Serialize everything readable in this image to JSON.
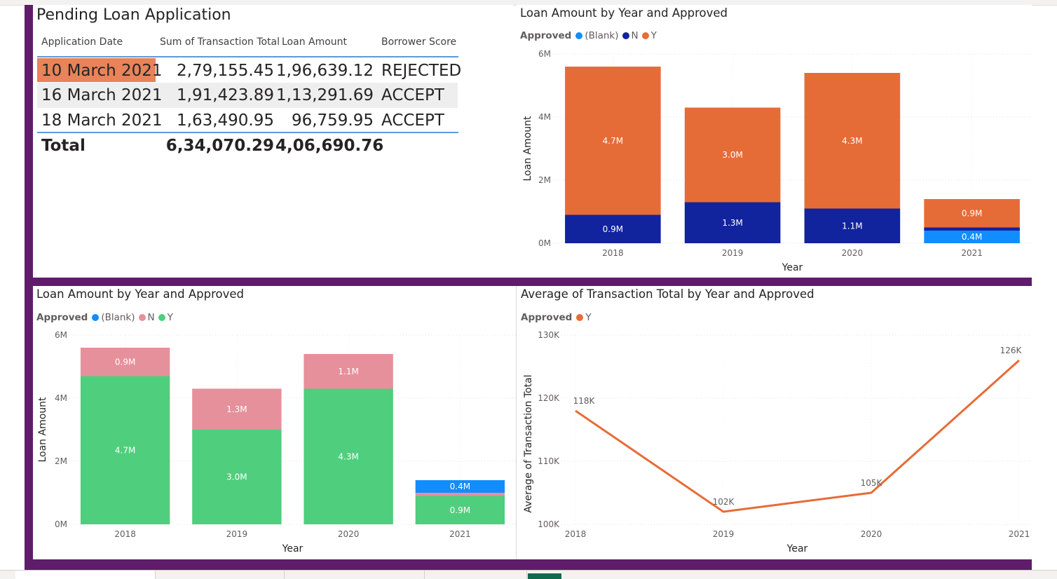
{
  "table": {
    "title": "Pending Loan Application",
    "columns": [
      "Application Date",
      "Sum of Transaction Total",
      "Loan Amount",
      "Borrower Score"
    ],
    "rows": [
      {
        "date": "10 March 2021",
        "transaction": "2,79,155.45",
        "loan": "1,96,639.12",
        "score": "REJECTED"
      },
      {
        "date": "16 March 2021",
        "transaction": "1,91,423.89",
        "loan": "1,13,291.69",
        "score": "ACCEPT"
      },
      {
        "date": "18 March 2021",
        "transaction": "1,63,490.95",
        "loan": "96,759.95",
        "score": "ACCEPT"
      }
    ],
    "total": {
      "label": "Total",
      "transaction": "6,34,070.29",
      "loan": "4,06,690.76"
    },
    "highlight_color": "#e8835a"
  },
  "chart_data": [
    {
      "type": "bar",
      "stacked": true,
      "title": "Loan Amount by Year and Approved",
      "legend_title": "Approved",
      "xlabel": "Year",
      "ylabel": "Loan Amount",
      "categories": [
        "2018",
        "2019",
        "2020",
        "2021"
      ],
      "ylim": [
        0,
        6
      ],
      "yticks": [
        "0M",
        "2M",
        "4M",
        "6M"
      ],
      "series": [
        {
          "name": "(Blank)",
          "color": "#118dff",
          "values": [
            0,
            0,
            0,
            0.4
          ],
          "labels": [
            "",
            "",
            "",
            "0.4M"
          ]
        },
        {
          "name": "N",
          "color": "#12239e",
          "values": [
            0.9,
            1.3,
            1.1,
            0.1
          ],
          "labels": [
            "0.9M",
            "1.3M",
            "1.1M",
            ""
          ]
        },
        {
          "name": "Y",
          "color": "#e66c37",
          "values": [
            4.7,
            3.0,
            4.3,
            0.9
          ],
          "labels": [
            "4.7M",
            "3.0M",
            "4.3M",
            "0.9M"
          ]
        }
      ],
      "grid": true,
      "legend_position": "top-left"
    },
    {
      "type": "bar",
      "stacked": true,
      "title": "Loan Amount by Year and Approved",
      "legend_title": "Approved",
      "xlabel": "Year",
      "ylabel": "Loan Amount",
      "categories": [
        "2018",
        "2019",
        "2020",
        "2021"
      ],
      "ylim": [
        0,
        6
      ],
      "yticks": [
        "0M",
        "2M",
        "4M",
        "6M"
      ],
      "series": [
        {
          "name": "Y",
          "color": "#4fce7e",
          "values": [
            4.7,
            3.0,
            4.3,
            0.9
          ],
          "labels": [
            "4.7M",
            "3.0M",
            "4.3M",
            "0.9M"
          ]
        },
        {
          "name": "N",
          "color": "#e6909b",
          "values": [
            0.9,
            1.3,
            1.1,
            0.1
          ],
          "labels": [
            "0.9M",
            "1.3M",
            "1.1M",
            ""
          ]
        },
        {
          "name": "(Blank)",
          "color": "#118dff",
          "values": [
            0,
            0,
            0,
            0.4
          ],
          "labels": [
            "",
            "",
            "",
            "0.4M"
          ]
        }
      ],
      "legend_order": [
        "(Blank)",
        "N",
        "Y"
      ],
      "grid": true,
      "legend_position": "top-left"
    },
    {
      "type": "line",
      "title": "Average of Transaction Total by Year and Approved",
      "legend_title": "Approved",
      "xlabel": "Year",
      "ylabel": "Average of Transaction Total",
      "x": [
        "2018",
        "2019",
        "2020",
        "2021"
      ],
      "ylim": [
        100,
        130
      ],
      "yticks": [
        "100K",
        "110K",
        "120K",
        "130K"
      ],
      "series": [
        {
          "name": "Y",
          "color": "#e66c37",
          "values": [
            118,
            102,
            105,
            126
          ],
          "labels": [
            "118K",
            "102K",
            "105K",
            "126K"
          ]
        }
      ],
      "grid": true,
      "legend_position": "top-left"
    }
  ]
}
